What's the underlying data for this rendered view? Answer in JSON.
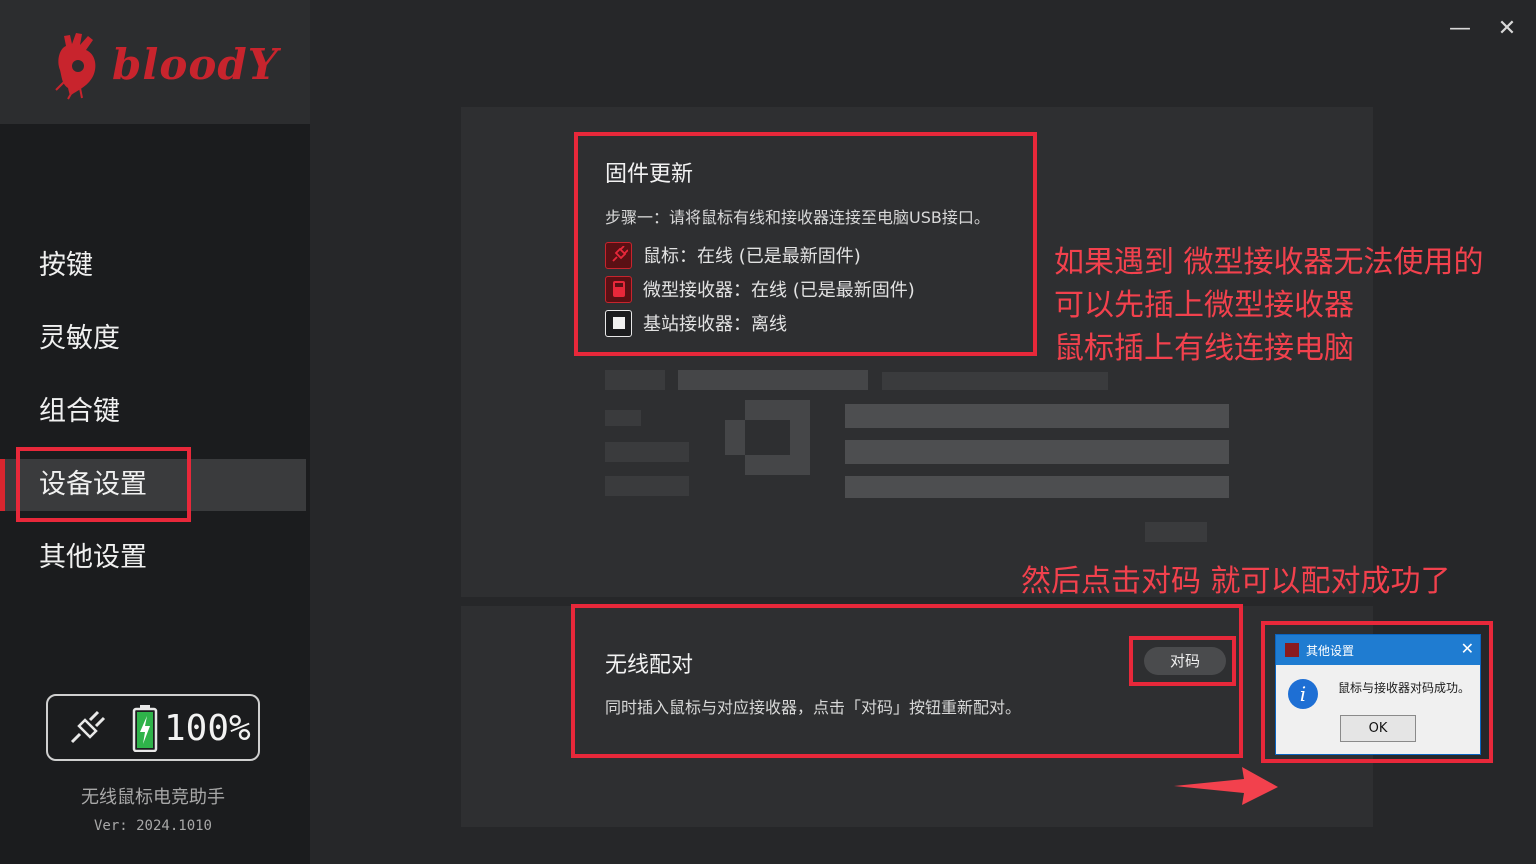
{
  "brand": {
    "logo_text": "bloodY",
    "color": "#c8242d"
  },
  "window": {
    "minimize_label": "—",
    "close_label": "✕"
  },
  "sidebar": {
    "items": [
      {
        "label": "按键"
      },
      {
        "label": "灵敏度"
      },
      {
        "label": "组合键"
      },
      {
        "label": "设备设置",
        "active": true
      },
      {
        "label": "其他设置"
      }
    ],
    "battery": {
      "percent": "100%",
      "level": 1.0
    },
    "app_name": "无线鼠标电竞助手",
    "version": "Ver: 2024.1010"
  },
  "firmware": {
    "title": "固件更新",
    "step": "步骤一：请将鼠标有线和接收器连接至电脑USB接口。",
    "devices": [
      {
        "icon": "mouse-icon",
        "label": "鼠标：在线 (已是最新固件)"
      },
      {
        "icon": "receiver-icon",
        "label": "微型接收器：在线 (已是最新固件)"
      },
      {
        "icon": "base-station-icon",
        "label": "基站接收器：离线"
      }
    ]
  },
  "pairing": {
    "title": "无线配对",
    "description": "同时插入鼠标与对应接收器，点击「对码」按钮重新配对。",
    "button_label": "对码"
  },
  "annotations": {
    "line1": "如果遇到 微型接收器无法使用的",
    "line2": "可以先插上微型接收器",
    "line3": "鼠标插上有线连接电脑",
    "line4": "然后点击对码 就可以配对成功了",
    "color": "#f2414d"
  },
  "dialog": {
    "title": "其他设置",
    "close_label": "✕",
    "message": "鼠标与接收器对码成功。",
    "ok_label": "OK",
    "info_glyph": "i"
  }
}
